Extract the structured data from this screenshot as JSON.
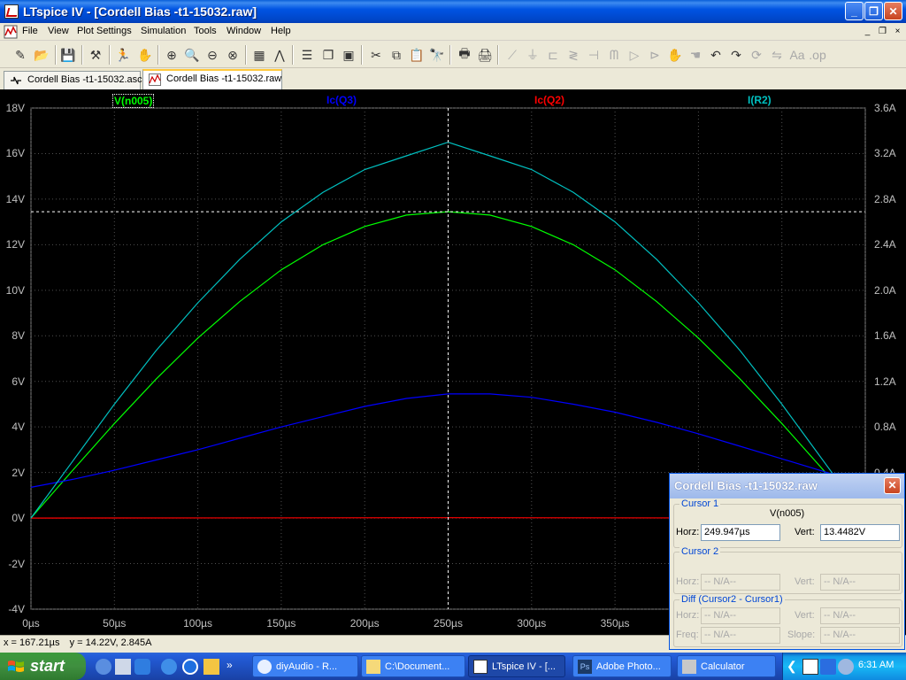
{
  "window": {
    "title": "LTspice IV - [Cordell Bias -t1-15032.raw]",
    "minimize": "_",
    "restore": "❐",
    "close": "✕"
  },
  "menu": [
    "File",
    "View",
    "Plot Settings",
    "Simulation",
    "Tools",
    "Window",
    "Help"
  ],
  "mdi": {
    "minimize": "_",
    "restore": "❐",
    "close": "×"
  },
  "tabs": [
    {
      "label": "Cordell Bias -t1-15032.asc",
      "active": false
    },
    {
      "label": "Cordell Bias -t1-15032.raw",
      "active": true
    }
  ],
  "plot": {
    "traces": [
      {
        "name": "V(n005)",
        "color": "#00FF00"
      },
      {
        "name": "Ic(Q3)",
        "color": "#0000FF"
      },
      {
        "name": "Ic(Q2)",
        "color": "#FF0000"
      },
      {
        "name": "I(R2)",
        "color": "#00C0C0"
      }
    ],
    "left_ticks": [
      "18V",
      "16V",
      "14V",
      "12V",
      "10V",
      "8V",
      "6V",
      "4V",
      "2V",
      "0V",
      "-2V",
      "-4V"
    ],
    "right_ticks": [
      "3.6A",
      "3.2A",
      "2.8A",
      "2.4A",
      "2.0A",
      "1.6A",
      "1.2A",
      "0.8A",
      "0.4A"
    ],
    "x_ticks": [
      "0µs",
      "50µs",
      "100µs",
      "150µs",
      "200µs",
      "250µs",
      "300µs",
      "350µs",
      "400µs"
    ]
  },
  "chart_data": {
    "type": "line",
    "x_unit": "µs",
    "xlim": [
      0,
      500
    ],
    "ylim_left": [
      -4,
      18
    ],
    "ylim_right": [
      -0.8,
      3.6
    ],
    "series": [
      {
        "name": "V(n005)",
        "axis": "left",
        "color": "#00FF00",
        "x": [
          0,
          25,
          50,
          75,
          100,
          125,
          150,
          175,
          200,
          225,
          250,
          275,
          300,
          325,
          350,
          375,
          400,
          425,
          450,
          475,
          500
        ],
        "y": [
          0,
          2.1,
          4.15,
          6.1,
          7.9,
          9.5,
          10.9,
          12.0,
          12.8,
          13.3,
          13.45,
          13.3,
          12.8,
          12.0,
          10.9,
          9.5,
          7.9,
          6.1,
          4.15,
          2.1,
          0
        ]
      },
      {
        "name": "Ic(Q3)",
        "axis": "right",
        "color": "#0000FF",
        "x": [
          0,
          25,
          50,
          75,
          100,
          125,
          150,
          175,
          200,
          225,
          250,
          275,
          300,
          325,
          350,
          375,
          400,
          425,
          450,
          475,
          500
        ],
        "y": [
          0.27,
          0.34,
          0.42,
          0.51,
          0.6,
          0.7,
          0.8,
          0.89,
          0.98,
          1.05,
          1.09,
          1.09,
          1.06,
          1.0,
          0.93,
          0.84,
          0.74,
          0.63,
          0.52,
          0.41,
          0.3
        ]
      },
      {
        "name": "Ic(Q2)",
        "axis": "right",
        "color": "#FF0000",
        "x": [
          0,
          250,
          500
        ],
        "y": [
          0,
          0.003,
          0
        ]
      },
      {
        "name": "I(R2)",
        "axis": "right",
        "color": "#00C0C0",
        "x": [
          0,
          25,
          50,
          75,
          100,
          125,
          150,
          175,
          200,
          225,
          250,
          275,
          300,
          325,
          350,
          375,
          400,
          425,
          450,
          475,
          500
        ],
        "y": [
          0,
          0.5,
          1.0,
          1.47,
          1.89,
          2.27,
          2.6,
          2.86,
          3.06,
          3.18,
          3.3,
          3.18,
          3.06,
          2.86,
          2.6,
          2.27,
          1.89,
          1.47,
          1.0,
          0.5,
          0
        ]
      }
    ],
    "cursor": {
      "x": 250,
      "y": 13.4482
    },
    "grid": true
  },
  "statusbar": {
    "x_readout": "x = 167.21µs",
    "y_readout": "y = 14.22V, 2.845A"
  },
  "cursor_dialog": {
    "title": "Cordell Bias -t1-15032.raw",
    "cursor1": {
      "legend": "Cursor 1",
      "trace": "V(n005)",
      "horz_label": "Horz:",
      "horz": "249.947µs",
      "vert_label": "Vert:",
      "vert": "13.4482V"
    },
    "cursor2": {
      "legend": "Cursor 2",
      "horz_label": "Horz:",
      "horz": "-- N/A--",
      "vert_label": "Vert:",
      "vert": "-- N/A--"
    },
    "diff": {
      "legend": "Diff (Cursor2 - Cursor1)",
      "horz_label": "Horz:",
      "horz": "-- N/A--",
      "vert_label": "Vert:",
      "vert": "-- N/A--",
      "freq_label": "Freq:",
      "freq": "-- N/A--",
      "slope_label": "Slope:",
      "slope": "-- N/A--"
    }
  },
  "taskbar": {
    "start": "start",
    "tasks": [
      {
        "label": "diyAudio - R...",
        "active": false
      },
      {
        "label": "C:\\Document...",
        "active": false
      },
      {
        "label": "LTspice IV - [...",
        "active": true
      },
      {
        "label": "Adobe Photo...",
        "active": false
      },
      {
        "label": "Calculator",
        "active": false
      }
    ],
    "clock": "6:31 AM"
  }
}
